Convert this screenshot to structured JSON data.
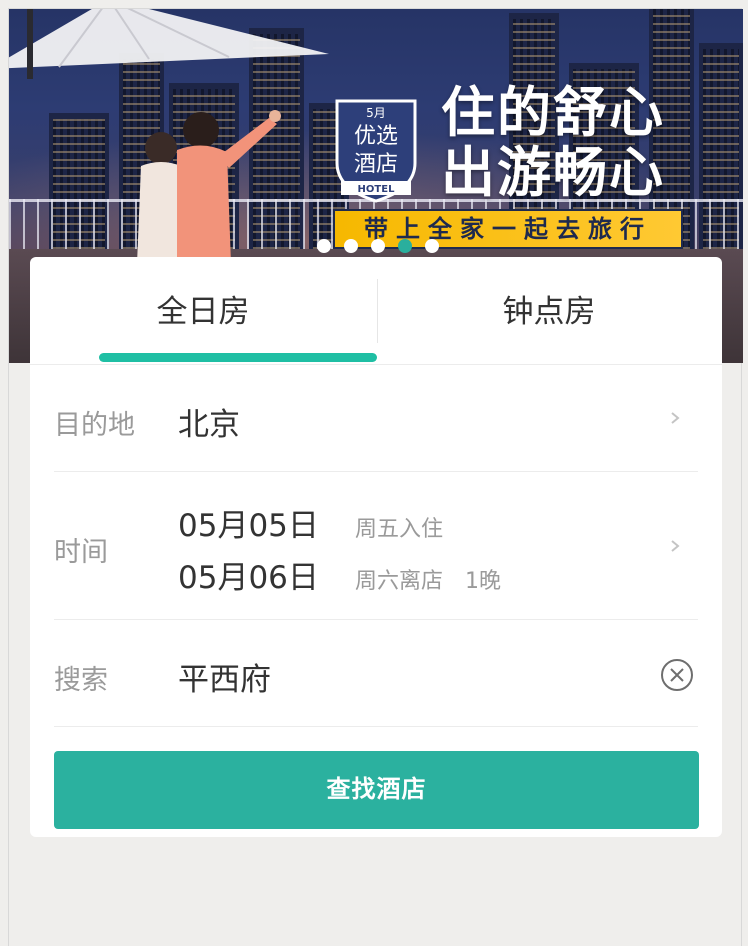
{
  "banner": {
    "promo_badge": {
      "month": "5月",
      "line1": "优选",
      "line2": "酒店",
      "ribbon": "HOTEL"
    },
    "headline_line1": "住的舒心",
    "headline_line2": "出游畅心",
    "tagline": "带上全家一起去旅行",
    "carousel": {
      "count": 5,
      "active_index": 3
    }
  },
  "tabs": [
    {
      "label": "全日房",
      "selected": true
    },
    {
      "label": "钟点房",
      "selected": false
    }
  ],
  "form": {
    "destination": {
      "label": "目的地",
      "value": "北京"
    },
    "time": {
      "label": "时间",
      "checkin_date": "05月05日",
      "checkin_note": "周五入住",
      "checkout_date": "05月06日",
      "checkout_note": "周六离店",
      "nights": "1晚"
    },
    "search": {
      "label": "搜索",
      "value": "平西府"
    }
  },
  "submit_label": "查找酒店",
  "colors": {
    "accent": "#2bb19f",
    "tab_indicator": "#1fbfa4",
    "tagline_bg": "#f6b800"
  }
}
